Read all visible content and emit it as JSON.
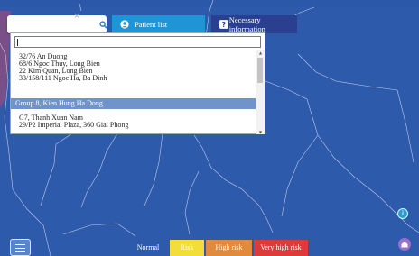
{
  "search": {
    "clear_icon": "×",
    "icon": "search-icon"
  },
  "tabs": {
    "patient_list": {
      "label": "Patient list",
      "icon": "user-circle-icon"
    },
    "necessary_info": {
      "label": "Necessary information",
      "icon": "question-icon"
    }
  },
  "dropdown": {
    "input_value": "",
    "addresses_group_a": [
      "32/76 An Duong",
      "68/6 Ngoc Thuy, Long Bien",
      "22 Kim Quan, Long Bien",
      "33/158/111 Ngoc Ha, Ba Dinh"
    ],
    "group_label": "Group 8, Kien Hung Ha Dong",
    "addresses_group_b": [
      "G7, Thanh Xuan Nam",
      "29/P2 Imperial Plaza, 360 Giai Phong"
    ]
  },
  "legend": {
    "normal": "Normal",
    "risk": "Risk",
    "high_risk": "High risk",
    "very_high_risk": "Very high risk"
  },
  "colors": {
    "map": "#2e5aac",
    "tab_patient": "#1e96d6",
    "tab_necessary": "#2a3f8f",
    "risk": "#f3dd3a",
    "high_risk": "#e08a3e",
    "very_high_risk": "#dd3a3a",
    "group_highlight": "#7093cc"
  },
  "buttons": {
    "info": "i"
  }
}
